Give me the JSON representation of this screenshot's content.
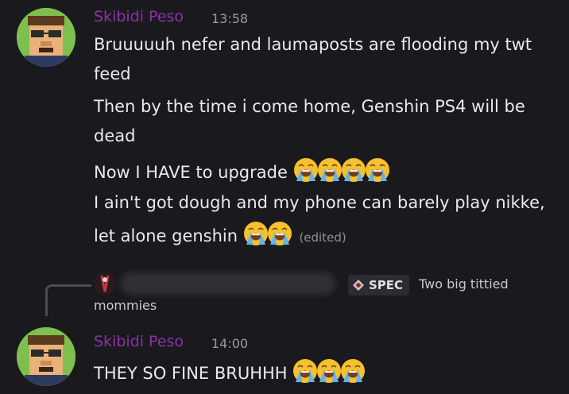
{
  "messages": [
    {
      "username": "Skibidi Peso",
      "timestamp": "13:58",
      "lines": [
        "Bruuuuuh nefer and laumaposts are flooding my twt",
        "feed",
        "Then by the time i come home, Genshin PS4 will be",
        "dead",
        "Now I HAVE to upgrade",
        "I ain't got dough and my phone can barely play nikke,",
        "let alone genshin"
      ],
      "edited_label": "(edited)"
    },
    {
      "reply": {
        "tag_label": "SPEC",
        "preview_line1": "Two big tittied",
        "preview_line2": "mommies"
      },
      "username": "Skibidi Peso",
      "timestamp": "14:00",
      "lines": [
        "THEY SO FINE BRUHHH"
      ]
    }
  ],
  "colors": {
    "background": "#1a1a1e",
    "username": "#b03ad6",
    "avatar_bg": "#7fbf4d"
  },
  "icons": [
    "loudly-crying-face-emoji",
    "spec-role-icon"
  ]
}
